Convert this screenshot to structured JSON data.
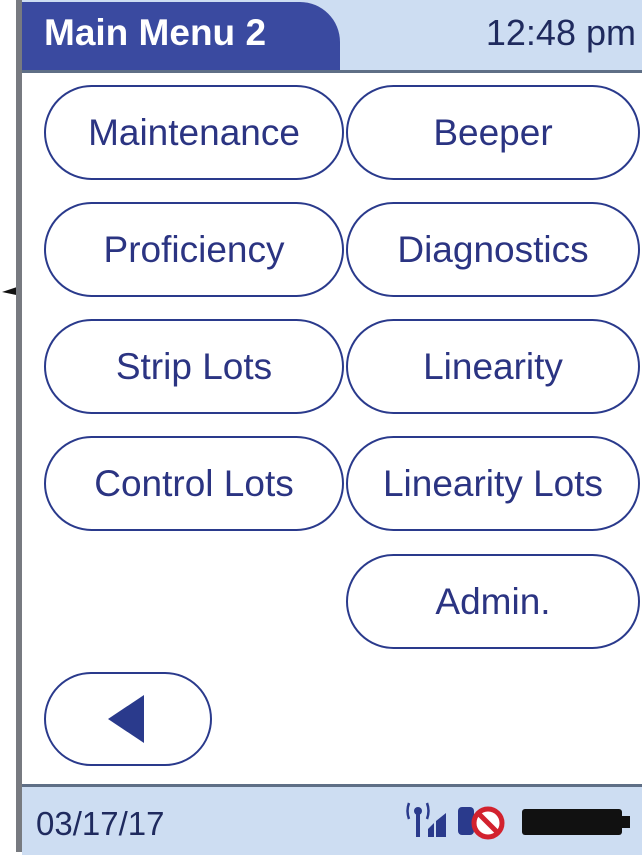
{
  "header": {
    "title": "Main Menu 2",
    "time": "12:48 pm"
  },
  "menu": {
    "maintenance": "Maintenance",
    "beeper": "Beeper",
    "proficiency": "Proficiency",
    "diagnostics": "Diagnostics",
    "strip_lots": "Strip Lots",
    "linearity": "Linearity",
    "control_lots": "Control Lots",
    "linearity_lots": "Linearity Lots",
    "admin": "Admin."
  },
  "navigation": {
    "back_icon": "left-triangle-icon"
  },
  "status": {
    "date": "03/17/17",
    "icons": [
      "wireless-signal-icon",
      "no-connection-icon",
      "battery-icon"
    ]
  },
  "colors": {
    "title_tab": "#3a4aa0",
    "bar_background": "#cdddf2",
    "button_text": "#2b3482",
    "button_border": "#2a3a8c"
  }
}
